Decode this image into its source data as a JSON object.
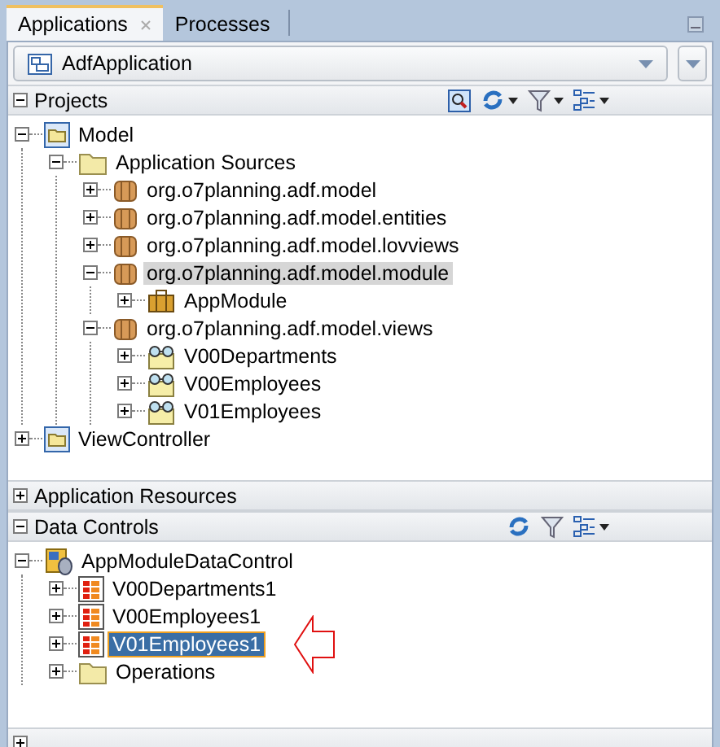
{
  "tabs": [
    {
      "label": "Applications",
      "selected": true,
      "closable": true
    },
    {
      "label": "Processes",
      "selected": false,
      "closable": false
    }
  ],
  "application_selector": {
    "value": "AdfApplication"
  },
  "projects": {
    "title": "Projects",
    "expanded": true,
    "tree": [
      {
        "label": "Model",
        "kind": "project",
        "expanded": true,
        "selected": false,
        "children": [
          {
            "label": "Application Sources",
            "kind": "folder",
            "expanded": true,
            "selected": false,
            "children": [
              {
                "label": "org.o7planning.adf.model",
                "kind": "package",
                "expanded": false,
                "selected": false
              },
              {
                "label": "org.o7planning.adf.model.entities",
                "kind": "package",
                "expanded": false,
                "selected": false
              },
              {
                "label": "org.o7planning.adf.model.lovviews",
                "kind": "package",
                "expanded": false,
                "selected": false
              },
              {
                "label": "org.o7planning.adf.model.module",
                "kind": "package",
                "expanded": true,
                "selected": true,
                "children": [
                  {
                    "label": "AppModule",
                    "kind": "appmodule",
                    "expanded": false,
                    "selected": false
                  }
                ]
              },
              {
                "label": "org.o7planning.adf.model.views",
                "kind": "package",
                "expanded": true,
                "selected": false,
                "children": [
                  {
                    "label": "V00Departments",
                    "kind": "view",
                    "expanded": false,
                    "selected": false
                  },
                  {
                    "label": "V00Employees",
                    "kind": "view",
                    "expanded": false,
                    "selected": false
                  },
                  {
                    "label": "V01Employees",
                    "kind": "view",
                    "expanded": false,
                    "selected": false
                  }
                ]
              }
            ]
          }
        ]
      },
      {
        "label": "ViewController",
        "kind": "project",
        "expanded": false,
        "selected": false
      }
    ]
  },
  "application_resources": {
    "title": "Application Resources",
    "expanded": false
  },
  "data_controls": {
    "title": "Data Controls",
    "expanded": true,
    "tree": [
      {
        "label": "AppModuleDataControl",
        "kind": "datacontrol",
        "expanded": true,
        "selected": false,
        "children": [
          {
            "label": "V00Departments1",
            "kind": "collection",
            "expanded": false,
            "selected": false
          },
          {
            "label": "V00Employees1",
            "kind": "collection",
            "expanded": false,
            "selected": false
          },
          {
            "label": "V01Employees1",
            "kind": "collection",
            "expanded": false,
            "selected": true,
            "pointer_arrow": true
          },
          {
            "label": "Operations",
            "kind": "folder",
            "expanded": false,
            "selected": false
          }
        ]
      }
    ]
  },
  "recent_files": {
    "expanded": false
  }
}
